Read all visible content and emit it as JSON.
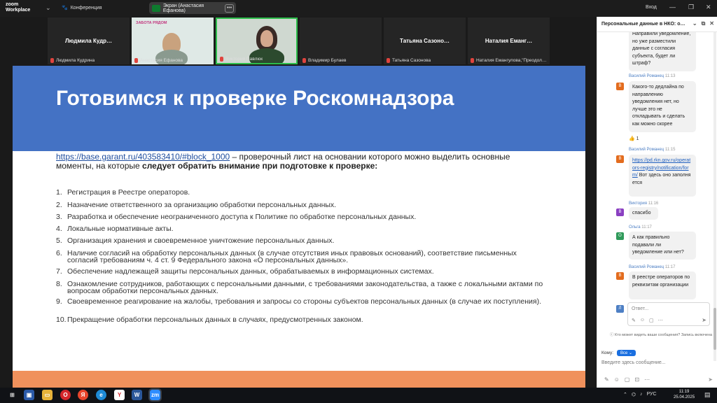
{
  "titlebar": {
    "brand_line1": "zoom",
    "brand_line2": "Workplace",
    "conference_label": "Конференция",
    "screen_share_label": "Экран (Анастасия Ефанова)",
    "login_label": "Вход"
  },
  "gallery": {
    "tiles": [
      {
        "center": "Людмила  Кудр…",
        "footer": "Людмила Кудрина"
      },
      {
        "logo": "ЗАБОТА РЯДОМ",
        "footer": "Анастасия Ефанова"
      },
      {
        "footer": "Виктория Павлюк"
      },
      {
        "footer": "Владимир Булаев"
      },
      {
        "center": "Татьяна  Сазоно…",
        "footer": "Татьяна Сазонова"
      },
      {
        "center": "Наталия  Еманг…",
        "footer": "Наталия Емангулова,\"Преодол…"
      }
    ]
  },
  "slide": {
    "title": "Готовимся к проверке Роскомнадзора",
    "intro_link": "https://base.garant.ru/403583410/#block_1000",
    "intro_text": " – проверочный лист на основании которого можно выделить основные моменты, на которые ",
    "intro_bold": "следует обратить внимание при подготовке к проверке:",
    "items": [
      {
        "num": "1.",
        "text": "Регистрация в Реестре операторов."
      },
      {
        "num": "2.",
        "text": "Назначение ответственного за организацию обработки персональных данных."
      },
      {
        "num": "3.",
        "text": "Разработка и обеспечение неограниченного доступа к Политике по обработке персональных данных."
      },
      {
        "num": "4.",
        "text": "Локальные нормативные акты."
      },
      {
        "num": "5.",
        "text": "Организация хранения и своевременное уничтожение персональных данных."
      },
      {
        "num": "6.",
        "text": "Наличие согласий на обработку персональных данных (в случае отсутствия иных правовых оснований), соответствие письменных согласий требованиям ч. 4 ст. 9 Федерального закона «О персональных данных»."
      },
      {
        "num": "7.",
        "text": "Обеспечение надлежащей защиты персональных данных, обрабатываемых в информационных системах."
      },
      {
        "num": "8.",
        "text": "Ознакомление сотрудников, работающих с персональными данными, с требованиями законодательства, а также с локальными актами по вопросам обработки персональных данных."
      },
      {
        "num": "9.",
        "text": "Своевременное реагирование на жалобы, требования и запросы со стороны субъектов персональных данных (в случае их поступления)."
      },
      {
        "num": "10.",
        "text": "Прекращение обработки персональных данных в случаях, предусмотренных законом."
      }
    ]
  },
  "chat": {
    "title": "Персональные данные в НКО: о…",
    "m0_text": "Направили уведомление, но уже разместили данные с согласия субъекта, будет ли штраф?",
    "m1_author": "Василий Романец",
    "m1_time": "11:13",
    "m1_text": "Какого-то дедлайна по направлению уведомления нет, но лучше это не откладывать и сделать как можно скорее",
    "m1_reaction": "👍 1",
    "m2_author": "Василий Романец",
    "m2_time": "11:15",
    "m2_link": "https://pd.rkn.gov.ru/operators-registry/notification/form/",
    "m2_text": "  Вот здесь оно заполняется",
    "m3_author": "Виктория",
    "m3_time": "11:16",
    "m3_text": "спасибо",
    "m4_author": "Ольга",
    "m4_time": "11:17",
    "m4_text": "А как правильно подавали ли уведомление или нет?",
    "m5_author": "Василий Романец",
    "m5_time": "11:17",
    "m5_text": "В реестре операторов по реквизитам организации",
    "avatar_v": "В",
    "avatar_o": "О",
    "avatar_l": "Л",
    "reply_placeholder": "Ответ...",
    "who_can_see": "Кто может видеть ваши сообщения? Запись включена",
    "to_label": "Кому:",
    "to_value": "Все",
    "input_placeholder": "Введите здесь сообщение..."
  },
  "taskbar": {
    "lang": "РУС",
    "time": "11:19",
    "date": "25.04.2025"
  }
}
